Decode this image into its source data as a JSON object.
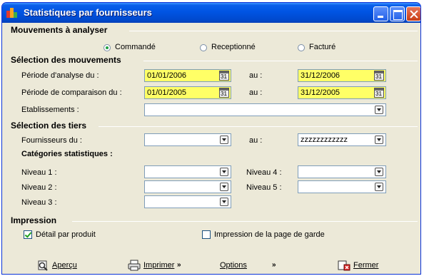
{
  "window": {
    "title": "Statistiques par fournisseurs"
  },
  "mouvements": {
    "heading": "Mouvements à analyser",
    "options": [
      "Commandé",
      "Receptionné",
      "Facturé"
    ],
    "selected": "Commandé"
  },
  "selection": {
    "heading": "Sélection des mouvements",
    "periode_label": "Période d'analyse du :",
    "periode_from": "01/01/2006",
    "au_label": "au :",
    "periode_to": "31/12/2006",
    "comparaison_label": "Période de comparaison du :",
    "comparaison_from": "01/01/2005",
    "comparaison_to": "31/12/2005",
    "etablissements_label": "Etablissements :",
    "etablissements_value": ""
  },
  "tiers": {
    "heading": "Sélection des tiers",
    "fournisseurs_label": "Fournisseurs du :",
    "fournisseurs_from": "",
    "au_label": "au :",
    "fournisseurs_to": "zzzzzzzzzzzz",
    "categories_heading": "Catégories statistiques :",
    "niveau1_label": "Niveau 1 :",
    "niveau2_label": "Niveau 2 :",
    "niveau3_label": "Niveau 3 :",
    "niveau4_label": "Niveau 4 :",
    "niveau5_label": "Niveau 5 :"
  },
  "impression": {
    "heading": "Impression",
    "detail_label": "Détail par produit",
    "detail_checked": true,
    "page_garde_label": "Impression de la page de garde",
    "page_garde_checked": false
  },
  "buttons": {
    "apercu": "Aperçu",
    "imprimer": "Imprimer",
    "options": "Options",
    "fermer": "Fermer"
  },
  "colors": {
    "titlebar": "#0054e3",
    "field_highlight": "#ffff66",
    "dialog_bg": "#ece9d8"
  }
}
